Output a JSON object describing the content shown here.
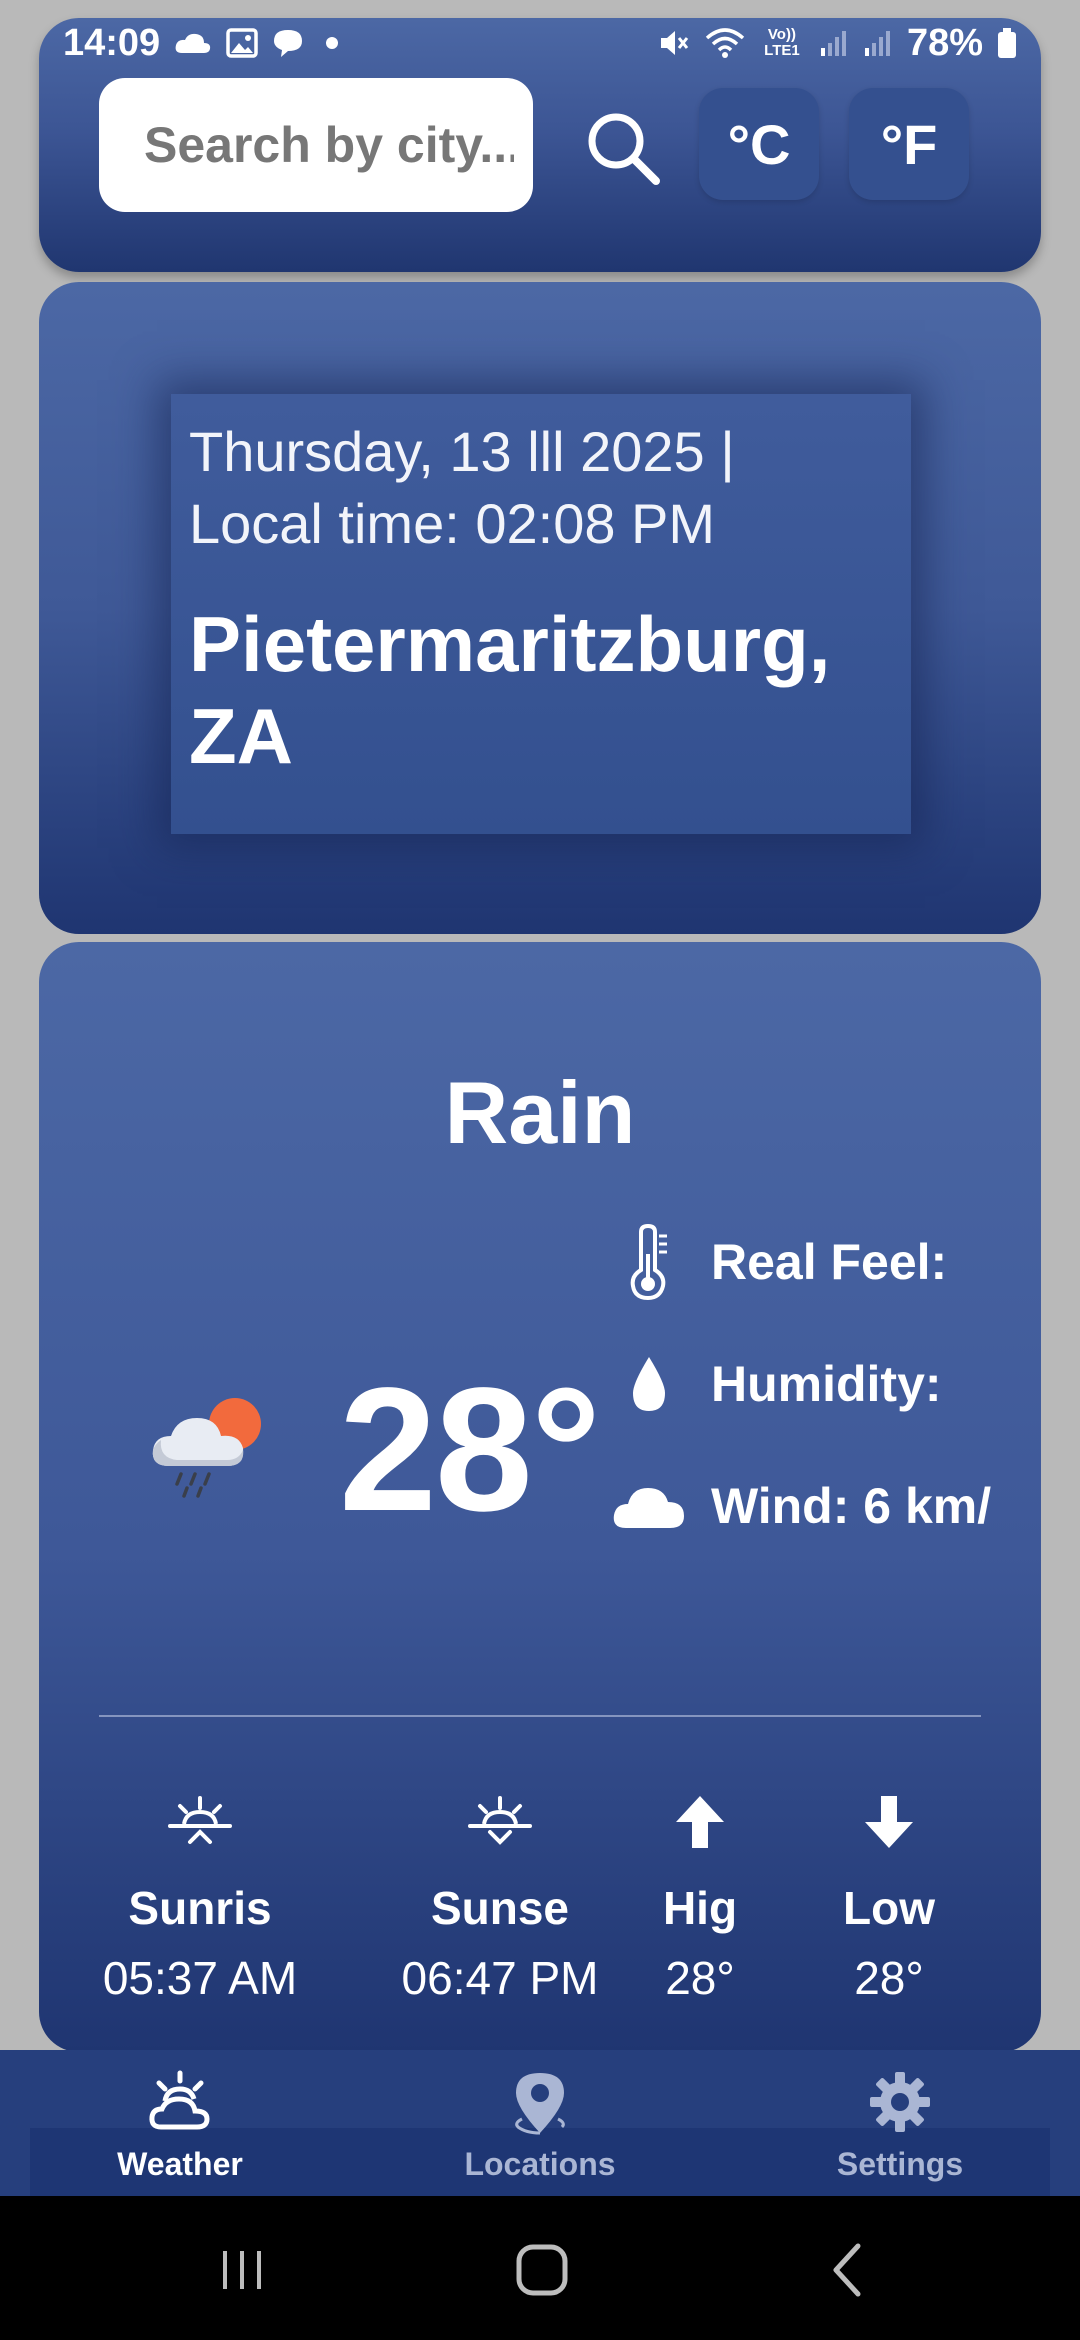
{
  "status_bar": {
    "time": "14:09",
    "battery": "78%",
    "left_icons": [
      "cloud-icon",
      "image-icon",
      "chat-bubble-icon",
      "dot-icon"
    ],
    "right_icons": [
      "mute-icon",
      "wifi-icon",
      "volte-icon",
      "signal-icon",
      "signal-icon",
      "battery-icon"
    ],
    "volte_label": "Vo)) LTE1"
  },
  "search": {
    "placeholder": "Search by city...",
    "value": ""
  },
  "units": {
    "celsius_label": "°C",
    "fahrenheit_label": "°F"
  },
  "location": {
    "date_line": "Thursday, 13 lll 2025 |",
    "time_line": "Local time: 02:08 PM",
    "city_line1": "Pietermaritzburg,",
    "city_line2": "ZA"
  },
  "weather": {
    "condition": "Rain",
    "temperature": "28°",
    "icon": "rain-cloud-sun-icon",
    "details": {
      "real_feel": "Real Feel:",
      "humidity": "Humidity:",
      "wind": "Wind: 6 km/"
    }
  },
  "sun": [
    {
      "label": "Sunris",
      "value": "05:37 AM",
      "icon": "sunrise-icon"
    },
    {
      "label": "Sunse",
      "value": "06:47 PM",
      "icon": "sunset-icon"
    },
    {
      "label": "Hig",
      "value": "28°",
      "icon": "arrow-up-icon"
    },
    {
      "label": "Low",
      "value": "28°",
      "icon": "arrow-down-icon"
    }
  ],
  "nav": {
    "items": [
      {
        "label": "Weather",
        "icon": "weather-icon",
        "active": true
      },
      {
        "label": "Locations",
        "icon": "location-pin-icon",
        "active": false
      },
      {
        "label": "Settings",
        "icon": "gear-icon",
        "active": false
      }
    ]
  },
  "colors": {
    "card_top": "#4c68a5",
    "card_bottom": "#1f3571",
    "nav_background": "#263f7d",
    "sun_accent": "#f26a3d"
  }
}
